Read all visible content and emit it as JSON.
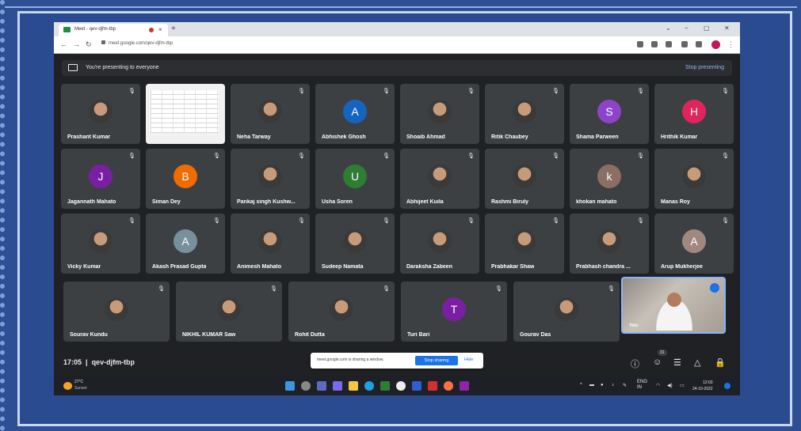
{
  "browser": {
    "tab_title": "Meet - qev-djfm-tbp",
    "tab_close": "×",
    "new_tab": "+",
    "window_controls": [
      "⌄",
      "−",
      "▢",
      "✕"
    ],
    "url": "meet.google.com/qev-djfm-tbp"
  },
  "meet": {
    "presenting_text": "You're presenting to everyone",
    "stop_presenting": "Stop presenting",
    "participants": [
      {
        "name": "Prashant Kumar",
        "avatar": "photo"
      },
      {
        "name": "",
        "avatar": "presentation"
      },
      {
        "name": "Neha Tarway",
        "avatar": "photo"
      },
      {
        "name": "Abhishek Ghosh",
        "avatar": "letter",
        "letter": "A",
        "color": "#1565c0"
      },
      {
        "name": "Shoaib Ahmad",
        "avatar": "photo"
      },
      {
        "name": "Ritik Chaubey",
        "avatar": "photo"
      },
      {
        "name": "Shama Parween",
        "avatar": "letter",
        "letter": "S",
        "color": "#8e44c9"
      },
      {
        "name": "Hrithik Kumar",
        "avatar": "letter",
        "letter": "H",
        "color": "#e0245e"
      },
      {
        "name": "Jagannath Mahato",
        "avatar": "letter",
        "letter": "J",
        "color": "#7b1fa2"
      },
      {
        "name": "Siman Dey",
        "avatar": "letter",
        "letter": "B",
        "color": "#ef6c00"
      },
      {
        "name": "Pankaj singh Kushw...",
        "avatar": "photo"
      },
      {
        "name": "Usha Soren",
        "avatar": "letter",
        "letter": "U",
        "color": "#2e7d32"
      },
      {
        "name": "Abhijeet Kuila",
        "avatar": "photo"
      },
      {
        "name": "Rashmi Biruly",
        "avatar": "photo"
      },
      {
        "name": "khokan mahato",
        "avatar": "letter",
        "letter": "k",
        "color": "#8d6e63"
      },
      {
        "name": "Manas Roy",
        "avatar": "photo"
      },
      {
        "name": "Vicky Kumar",
        "avatar": "photo"
      },
      {
        "name": "Akash Prasad Gupta",
        "avatar": "letter",
        "letter": "A",
        "color": "#78909c"
      },
      {
        "name": "Animesh Mahato",
        "avatar": "photo"
      },
      {
        "name": "Sudeep Namata",
        "avatar": "photo"
      },
      {
        "name": "Daraksha Zabeen",
        "avatar": "photo"
      },
      {
        "name": "Prabhakar Shaw",
        "avatar": "photo"
      },
      {
        "name": "Prabhash chandra ...",
        "avatar": "photo"
      },
      {
        "name": "Arup Mukherjee",
        "avatar": "letter",
        "letter": "A",
        "color": "#a1887f"
      },
      {
        "name": "Sourav Kundu",
        "avatar": "photo"
      },
      {
        "name": "NIKHIL KUMAR Saw",
        "avatar": "photo"
      },
      {
        "name": "Rohit Dutta",
        "avatar": "photo"
      },
      {
        "name": "Turi Bari",
        "avatar": "letter",
        "letter": "T",
        "color": "#7b1fa2"
      },
      {
        "name": "Gourav Das",
        "avatar": "photo"
      },
      {
        "name": "You",
        "avatar": "video"
      }
    ],
    "mic_icon": "🎙",
    "meeting_time": "17:05",
    "meeting_code": "qev-djfm-tbp",
    "people_count": "31"
  },
  "share_popup": {
    "message": "meet.google.com is sharing a window.",
    "stop_label": "Stop sharing",
    "hide_label": "Hide"
  },
  "taskbar": {
    "weather_temp": "27°C",
    "weather_desc": "Sunset",
    "lang": "ENG",
    "region": "IN",
    "time": "12:03",
    "date": "24-10-2022"
  }
}
